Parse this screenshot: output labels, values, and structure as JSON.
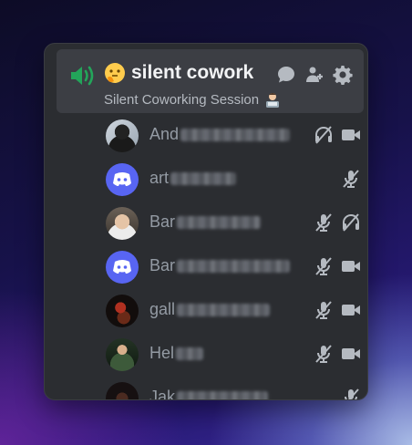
{
  "channel": {
    "name": "silent cowork",
    "topic": "Silent Coworking Session",
    "icons": [
      "speaker-icon",
      "thinking-emoji",
      "chat-bubble-icon",
      "add-member-icon",
      "gear-icon"
    ]
  },
  "users": [
    {
      "name_visible": "And",
      "avatar": "photo-person",
      "status": [
        "deafened-icon",
        "video-icon"
      ]
    },
    {
      "name_visible": "art",
      "avatar": "discord-default",
      "status": [
        "muted-icon"
      ]
    },
    {
      "name_visible": "Bar",
      "avatar": "photo-person",
      "status": [
        "muted-icon",
        "deafened-icon"
      ]
    },
    {
      "name_visible": "Bar",
      "avatar": "discord-default",
      "status": [
        "muted-icon",
        "video-icon"
      ]
    },
    {
      "name_visible": "gall",
      "avatar": "photo-dark",
      "status": [
        "muted-icon",
        "video-icon"
      ]
    },
    {
      "name_visible": "Hel",
      "avatar": "photo-person",
      "status": [
        "muted-icon",
        "video-icon"
      ]
    },
    {
      "name_visible": "Jak",
      "avatar": "photo-dark",
      "status": [
        "muted-icon"
      ]
    }
  ],
  "colors": {
    "panel_bg": "#2b2d31",
    "channel_bg": "#3c3e44",
    "speaker_green": "#23a55a",
    "discord_blurple": "#5865f2",
    "icon_gray": "#b5bac1"
  }
}
